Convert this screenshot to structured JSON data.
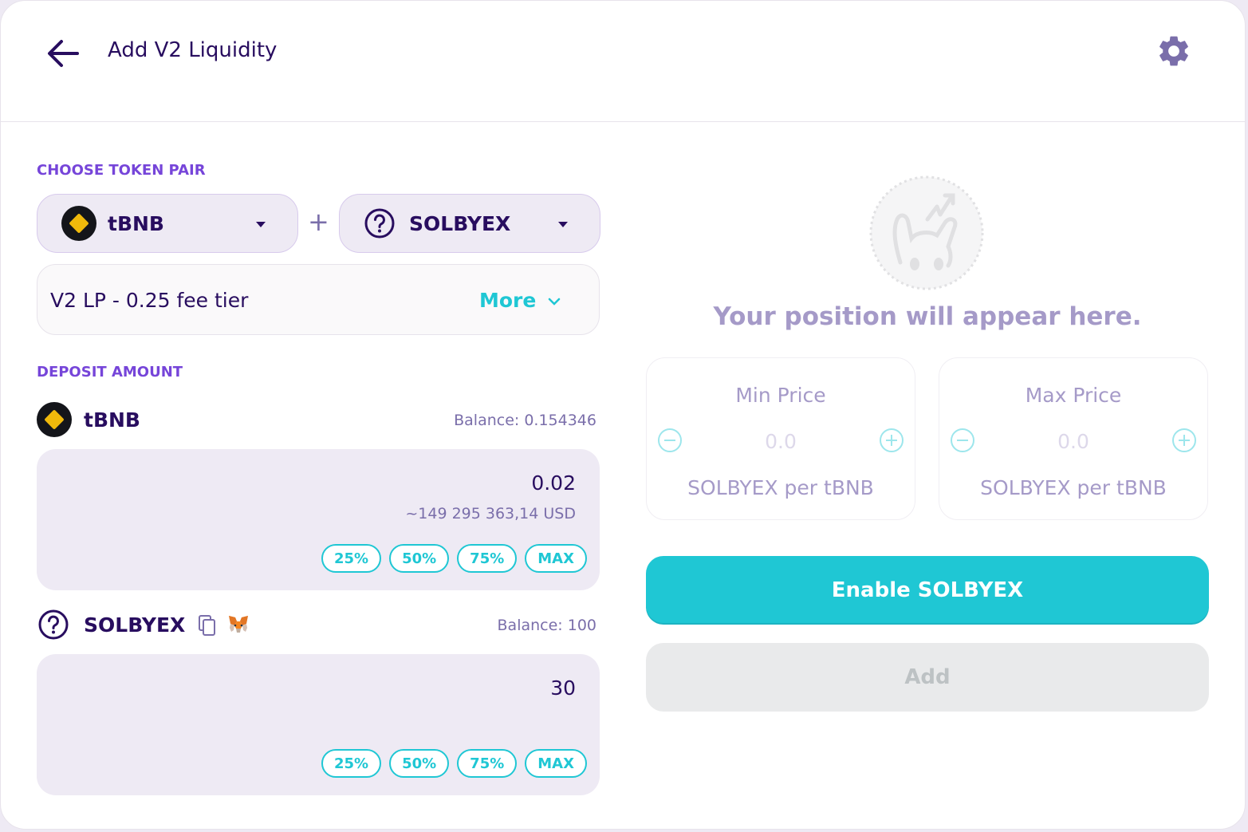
{
  "header": {
    "title": "Add V2 Liquidity",
    "back_icon": "arrow-left-icon",
    "settings_icon": "gear-icon"
  },
  "pair": {
    "section_label": "CHOOSE TOKEN PAIR",
    "token_a": "tBNB",
    "token_b": "SOLBYEX",
    "plus": "+"
  },
  "fee_tier": {
    "label": "V2 LP - 0.25 fee tier",
    "more_label": "More"
  },
  "deposit": {
    "section_label": "DEPOSIT AMOUNT",
    "token_a": {
      "symbol": "tBNB",
      "balance": "Balance: 0.154346",
      "amount": "0.02",
      "usd": "~149 295 363,14 USD",
      "pct": [
        "25%",
        "50%",
        "75%",
        "MAX"
      ]
    },
    "token_b": {
      "symbol": "SOLBYEX",
      "balance": "Balance: 100",
      "amount": "30",
      "pct": [
        "25%",
        "50%",
        "75%",
        "MAX"
      ]
    }
  },
  "position": {
    "placeholder": "Your position will appear here.",
    "min_price": {
      "title": "Min Price",
      "value": "0.0",
      "unit": "SOLBYEX per tBNB"
    },
    "max_price": {
      "title": "Max Price",
      "value": "0.0",
      "unit": "SOLBYEX per tBNB"
    }
  },
  "actions": {
    "enable_label": "Enable SOLBYEX",
    "add_label": "Add"
  },
  "colors": {
    "primary": "#1fc7d4",
    "secondary": "#7645d9",
    "text": "#280d5f",
    "text_subtle": "#7a6eaa",
    "input_bg": "#eeeaf4",
    "disabled_bg": "#e9eaeb"
  }
}
